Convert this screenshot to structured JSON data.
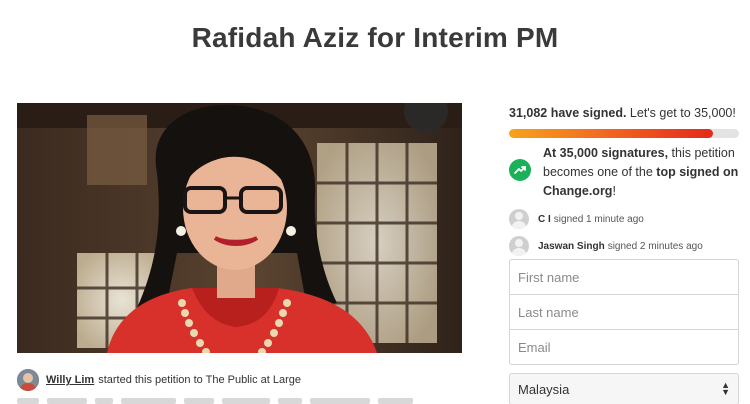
{
  "page": {
    "title": "Rafidah Aziz for Interim PM"
  },
  "petition": {
    "author": "Willy Lim",
    "started_text": "started this petition to The Public at Large"
  },
  "progress": {
    "signed_count": "31,082 have signed.",
    "goal_text": "Let's get to 35,000!",
    "fraction": 0.888,
    "gradient_colors": [
      "#f7a31c",
      "#f16b20",
      "#e5281c"
    ]
  },
  "milestone": {
    "icon": "trending-up-icon",
    "icon_color": "#1bb05a",
    "part1": "At 35,000 signatures,",
    "part2": "this petition becomes one of the",
    "part3": "top signed on Change.org",
    "part4": "!"
  },
  "recent_signers": [
    {
      "name": "C I",
      "text": "signed 1 minute ago"
    },
    {
      "name": "Jaswan Singh",
      "text": "signed 2 minutes ago"
    }
  ],
  "form": {
    "first_name_placeholder": "First name",
    "last_name_placeholder": "Last name",
    "email_placeholder": "Email",
    "country_value": "Malaysia"
  }
}
